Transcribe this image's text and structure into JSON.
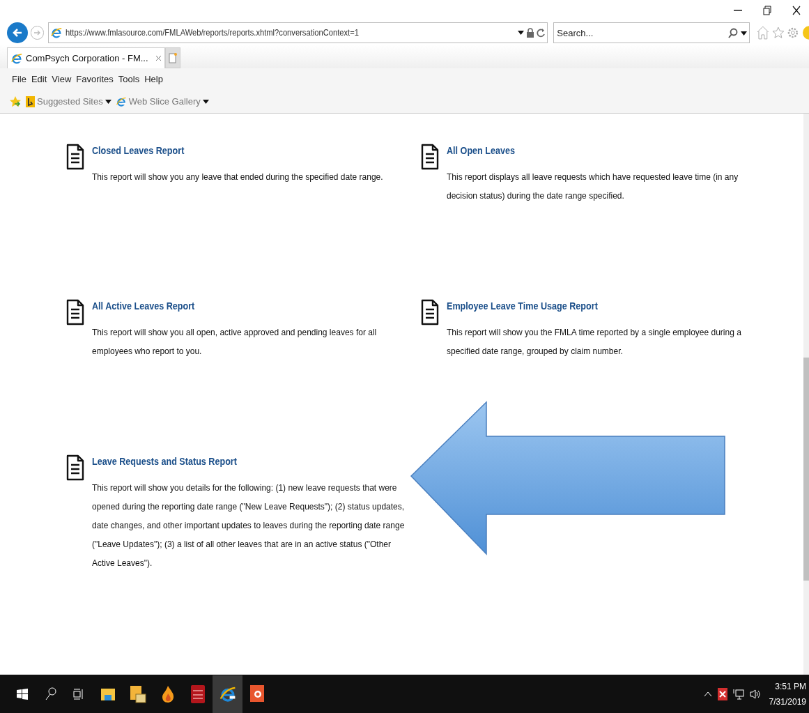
{
  "browser": {
    "address": "https://www.fmlasource.com/FMLAWeb/reports/reports.xhtml?conversationContext=1",
    "search": {
      "placeholder": "Search..."
    },
    "tabs": [
      {
        "label": "ComPsych Corporation - FM...",
        "selected": true
      }
    ],
    "menu": [
      "File",
      "Edit",
      "View",
      "Favorites",
      "Tools",
      "Help"
    ],
    "favorites": [
      {
        "label": "Suggested Sites"
      },
      {
        "label": "Web Slice Gallery"
      }
    ]
  },
  "reports": [
    {
      "title": "Closed Leaves Report",
      "description": "This report will show you any leave that ended during the specified date range."
    },
    {
      "title": "All Open Leaves",
      "description": "This report displays all leave requests which have requested leave time (in any decision status) during the date range specified."
    },
    {
      "title": "All Active Leaves Report",
      "description": "This report will show you all open, active approved and pending leaves for all employees who report to you."
    },
    {
      "title": "Employee Leave Time Usage Report",
      "description": "This report will show you the FMLA time reported by a single employee during a specified date range, grouped by claim number."
    },
    {
      "title": "Leave Requests and Status Report",
      "description": "This report will show you details for the following: (1) new leave requests that were opened during the reporting date range (\"New Leave Requests\"); (2) status updates, date changes, and other important updates to leaves during the reporting date range (\"Leave Updates\"); (3) a list of all other leaves that are in an active status (\"Other Active Leaves\")."
    }
  ],
  "taskbar": {
    "apps": [
      {
        "kind": "explorer",
        "selected": false
      },
      {
        "kind": "outlook",
        "selected": false
      },
      {
        "kind": "flame",
        "selected": false
      },
      {
        "kind": "avaya",
        "selected": false
      },
      {
        "kind": "ie",
        "selected": true
      },
      {
        "kind": "powerpoint",
        "selected": false
      }
    ],
    "time": "3:51 PM",
    "date": "7/31/2019"
  }
}
